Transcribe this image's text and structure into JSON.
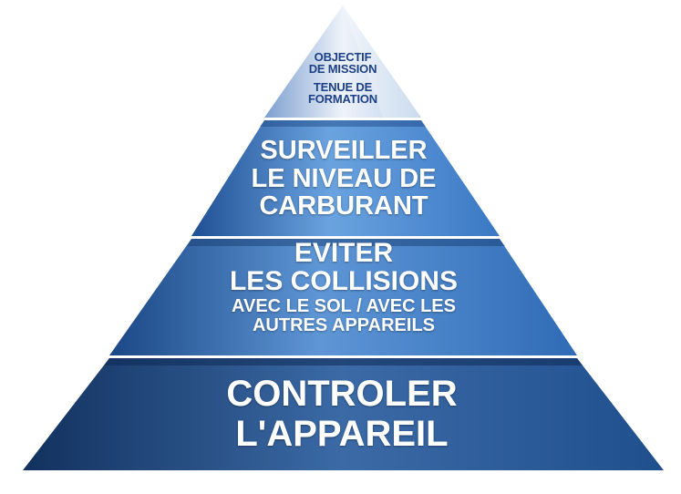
{
  "pyramid": {
    "tiers": [
      {
        "id": "top",
        "lines": [
          "OBJECTIF",
          "DE MISSION",
          "TENUE DE",
          "FORMATION"
        ],
        "colors": {
          "light": "#eef3fa",
          "mid": "#b9cfe8",
          "dark": "#7c9fcf"
        }
      },
      {
        "id": "fuel",
        "lines": [
          "SURVEILLER",
          "LE NIVEAU DE",
          "CARBURANT"
        ],
        "colors": {
          "light": "#6aa3e0",
          "mid": "#3a78c4",
          "dark": "#1f4f93"
        }
      },
      {
        "id": "collisions",
        "lines": [
          "EVITER",
          "LES COLLISIONS",
          "AVEC LE SOL / AVEC LES",
          "AUTRES APPAREILS"
        ],
        "colors": {
          "light": "#5e96d6",
          "mid": "#2f6bb6",
          "dark": "#1b4785"
        }
      },
      {
        "id": "control",
        "lines": [
          "CONTROLER",
          "L'APPAREIL"
        ],
        "colors": {
          "light": "#3b6aa6",
          "mid": "#204f8e",
          "dark": "#12315e"
        }
      }
    ]
  }
}
